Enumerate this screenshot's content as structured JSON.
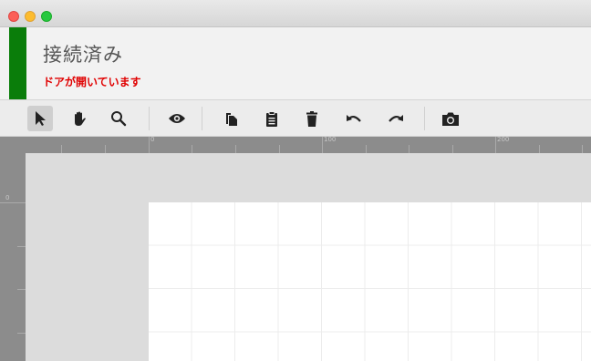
{
  "window": {
    "controls": [
      "close",
      "minimize",
      "zoom"
    ]
  },
  "status": {
    "title": "接続済み",
    "subtitle": "ドアが開いています",
    "accent_color": "#0a7d0a",
    "alert_color": "#e00000"
  },
  "toolbar": {
    "tools": [
      {
        "name": "select",
        "icon": "arrow-pointer-icon",
        "active": true
      },
      {
        "name": "pan",
        "icon": "hand-icon",
        "active": false
      },
      {
        "name": "zoom",
        "icon": "magnifier-icon",
        "active": false
      },
      {
        "name": "preview",
        "icon": "eye-icon",
        "active": false
      },
      {
        "name": "copy",
        "icon": "copy-icon",
        "active": false
      },
      {
        "name": "paste",
        "icon": "clipboard-icon",
        "active": false
      },
      {
        "name": "delete",
        "icon": "trash-icon",
        "active": false
      },
      {
        "name": "undo",
        "icon": "undo-icon",
        "active": false
      },
      {
        "name": "redo",
        "icon": "redo-icon",
        "active": false
      },
      {
        "name": "snapshot",
        "icon": "camera-icon",
        "active": false
      }
    ]
  },
  "ruler": {
    "top_labels": [
      "0",
      "100",
      "200"
    ],
    "left_labels": [
      "0"
    ]
  }
}
